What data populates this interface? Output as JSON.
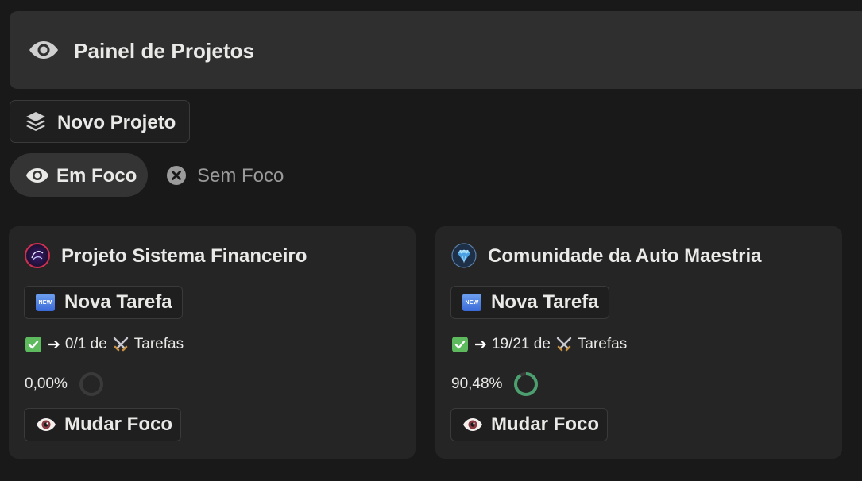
{
  "header": {
    "title": "Painel de Projetos",
    "icon": "eye-icon"
  },
  "toolbar": {
    "new_project_label": "Novo Projeto",
    "new_project_icon": "layers-icon"
  },
  "tabs": [
    {
      "label": "Em Foco",
      "icon": "eye-icon",
      "active": true
    },
    {
      "label": "Sem Foco",
      "icon": "x-circle-icon",
      "active": false
    }
  ],
  "projects": [
    {
      "title": "Projeto Sistema Financeiro",
      "icon": "logo-icon",
      "new_task_label": "Nova Tarefa",
      "new_badge": "NEW",
      "tasks_done": "0/1",
      "tasks_connector": "de",
      "tasks_word": "Tarefas",
      "percent_text": "0,00%",
      "progress": 0.0,
      "focus_label": "Mudar Foco"
    },
    {
      "title": "Comunidade da Auto Maestria",
      "icon": "gem-icon",
      "new_task_label": "Nova Tarefa",
      "new_badge": "NEW",
      "tasks_done": "19/21",
      "tasks_connector": "de",
      "tasks_word": "Tarefas",
      "percent_text": "90,48%",
      "progress": 0.9048,
      "focus_label": "Mudar Foco"
    }
  ],
  "colors": {
    "background": "#191919",
    "card": "#252525",
    "header": "#2f2f2f",
    "progress_ring": "#4c9f6f",
    "ring_track": "#3a3a3a"
  }
}
